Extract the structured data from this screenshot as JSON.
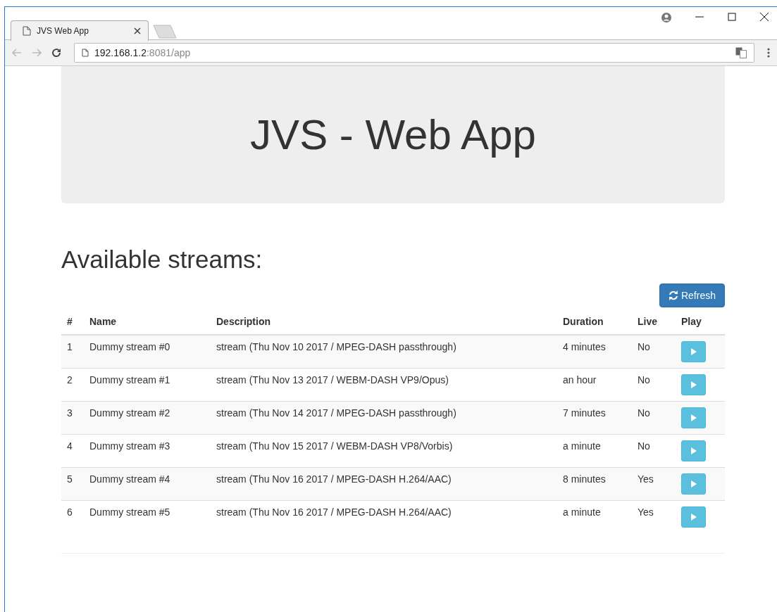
{
  "browser": {
    "tab_title": "JVS Web App",
    "url_host": "192.168.1.2",
    "url_rest": ":8081/app"
  },
  "page": {
    "title": "JVS - Web App",
    "heading": "Available streams:",
    "refresh_label": "Refresh"
  },
  "table": {
    "columns": [
      "#",
      "Name",
      "Description",
      "Duration",
      "Live",
      "Play"
    ],
    "rows": [
      {
        "index": "1",
        "name": "Dummy stream #0",
        "description": "stream (Thu Nov 10 2017 / MPEG-DASH passthrough)",
        "duration": "4 minutes",
        "live": "No"
      },
      {
        "index": "2",
        "name": "Dummy stream #1",
        "description": "stream (Thu Nov 13 2017 / WEBM-DASH VP9/Opus)",
        "duration": "an hour",
        "live": "No"
      },
      {
        "index": "3",
        "name": "Dummy stream #2",
        "description": "stream (Thu Nov 14 2017 / MPEG-DASH passthrough)",
        "duration": "7 minutes",
        "live": "No"
      },
      {
        "index": "4",
        "name": "Dummy stream #3",
        "description": "stream (Thu Nov 15 2017 / WEBM-DASH VP8/Vorbis)",
        "duration": "a minute",
        "live": "No"
      },
      {
        "index": "5",
        "name": "Dummy stream #4",
        "description": "stream (Thu Nov 16 2017 / MPEG-DASH H.264/AAC)",
        "duration": "8 minutes",
        "live": "Yes"
      },
      {
        "index": "6",
        "name": "Dummy stream #5",
        "description": "stream (Thu Nov 16 2017 / MPEG-DASH H.264/AAC)",
        "duration": "a minute",
        "live": "Yes"
      }
    ]
  }
}
